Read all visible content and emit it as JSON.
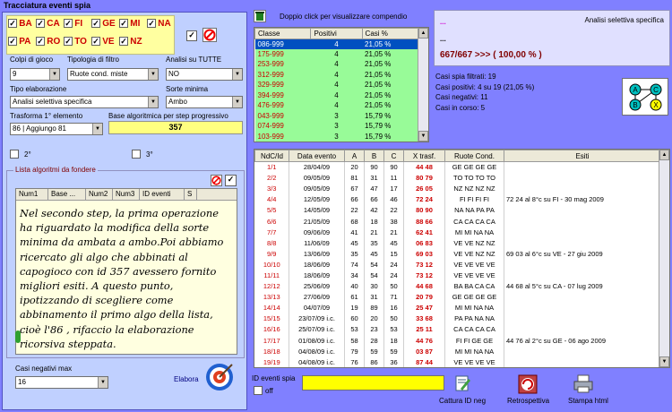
{
  "window": {
    "title": "Tracciatura eventi spia"
  },
  "wheels": [
    {
      "code": "BA",
      "checked": true
    },
    {
      "code": "CA",
      "checked": true
    },
    {
      "code": "FI",
      "checked": true
    },
    {
      "code": "GE",
      "checked": true
    },
    {
      "code": "MI",
      "checked": true
    },
    {
      "code": "NA",
      "checked": true
    },
    {
      "code": "PA",
      "checked": true
    },
    {
      "code": "RO",
      "checked": true
    },
    {
      "code": "TO",
      "checked": true
    },
    {
      "code": "VE",
      "checked": true
    },
    {
      "code": "NZ",
      "checked": true
    }
  ],
  "fields": {
    "colpi_label": "Colpi di gioco",
    "colpi_value": "9",
    "tipologia_label": "Tipologia di filtro",
    "tipologia_value": "Ruote cond. miste",
    "analisi_label": "Analisi su TUTTE",
    "analisi_value": "NO",
    "tipo_label": "Tipo elaborazione",
    "tipo_value": "Analisi selettiva specifica",
    "sorte_label": "Sorte minima",
    "sorte_value": "Ambo",
    "trasforma_label": "Trasforma 1° elemento",
    "trasforma_value": "86 | Aggiungo 81",
    "base_label": "Base algoritmica per step progressivo",
    "base_value": "357",
    "second_label": "2°",
    "third_label": "3°"
  },
  "fuse_list": {
    "title": "Lista algoritmi da fondere",
    "columns": [
      "Num1",
      "Base ...",
      "Num2",
      "Num3",
      "ID eventi",
      "S"
    ],
    "note": "Nel secondo step, la prima operazione ha riguardato la modifica della sorte minima da ambata a ambo.Poi abbiamo ricercato gli algo che abbinati al capogioco con id 357 avessero fornito migliori esiti. A questo punto, ipotizzando di scegliere come abbinamento il primo algo della lista, cioè l'86 , rifaccio la elaborazione ricorsiva steppata."
  },
  "casi_negativi": {
    "label": "Casi negativi max",
    "value": "16"
  },
  "elabora_label": "Elabora",
  "top_hint": "Doppio click per visualizzare compendio",
  "class_table": {
    "columns": [
      "Classe",
      "Positivi",
      "Casi %"
    ],
    "rows": [
      [
        "086-999",
        "4",
        "21,05 %"
      ],
      [
        "175-999",
        "4",
        "21,05 %"
      ],
      [
        "253-999",
        "4",
        "21,05 %"
      ],
      [
        "312-999",
        "4",
        "21,05 %"
      ],
      [
        "329-999",
        "4",
        "21,05 %"
      ],
      [
        "394-999",
        "4",
        "21,05 %"
      ],
      [
        "476-999",
        "4",
        "21,05 %"
      ],
      [
        "043-999",
        "3",
        "15,79 %"
      ],
      [
        "074-999",
        "3",
        "15,79 %"
      ],
      [
        "103-999",
        "3",
        "15,79 %"
      ]
    ]
  },
  "summary": {
    "mode": "Analisi selettiva specifica",
    "dots1": "...",
    "dots2": "...",
    "ratio": "667/667 >>> ( 100,00 % )",
    "stats": [
      "Casi spia filtrati: 19",
      "Casi positivi: 4 su 19 (21,05 %)",
      "Casi negativi: 11",
      "Casi in corso: 5"
    ]
  },
  "diagram": {
    "nodes": [
      "A",
      "C",
      "B",
      "X"
    ]
  },
  "events": {
    "columns": [
      "NdC/Id",
      "Data evento",
      "A",
      "B",
      "C",
      "X trasf.",
      "Ruote Cond.",
      "Esiti"
    ],
    "rows": [
      {
        "id": "1/1",
        "date": "28/04/09",
        "a": "20",
        "b": "90",
        "c": "90",
        "x": "44 48",
        "ruote": "GE GE GE GE",
        "esiti": ""
      },
      {
        "id": "2/2",
        "date": "09/05/09",
        "a": "81",
        "b": "31",
        "c": "11",
        "x": "80 79",
        "ruote": "TO TO TO TO",
        "esiti": ""
      },
      {
        "id": "3/3",
        "date": "09/05/09",
        "a": "67",
        "b": "47",
        "c": "17",
        "x": "26 05",
        "ruote": "NZ NZ NZ NZ",
        "esiti": ""
      },
      {
        "id": "4/4",
        "date": "12/05/09",
        "a": "66",
        "b": "66",
        "c": "46",
        "x": "72 24",
        "ruote": "FI FI FI FI",
        "esiti": "72 24 al 8°c su FI - 30 mag 2009"
      },
      {
        "id": "5/5",
        "date": "14/05/09",
        "a": "22",
        "b": "42",
        "c": "22",
        "x": "80 90",
        "ruote": "NA NA PA PA",
        "esiti": ""
      },
      {
        "id": "6/6",
        "date": "21/05/09",
        "a": "68",
        "b": "18",
        "c": "38",
        "x": "88 66",
        "ruote": "CA CA CA CA",
        "esiti": ""
      },
      {
        "id": "7/7",
        "date": "09/06/09",
        "a": "41",
        "b": "21",
        "c": "21",
        "x": "62 41",
        "ruote": "MI MI NA NA",
        "esiti": ""
      },
      {
        "id": "8/8",
        "date": "11/06/09",
        "a": "45",
        "b": "35",
        "c": "45",
        "x": "06 83",
        "ruote": "VE VE NZ NZ",
        "esiti": ""
      },
      {
        "id": "9/9",
        "date": "13/06/09",
        "a": "35",
        "b": "45",
        "c": "15",
        "x": "69 03",
        "ruote": "VE VE NZ NZ",
        "esiti": "69 03 al 6°c su VE - 27 giu 2009"
      },
      {
        "id": "10/10",
        "date": "18/06/09",
        "a": "74",
        "b": "54",
        "c": "24",
        "x": "73 12",
        "ruote": "VE VE VE VE",
        "esiti": ""
      },
      {
        "id": "11/11",
        "date": "18/06/09",
        "a": "34",
        "b": "54",
        "c": "24",
        "x": "73 12",
        "ruote": "VE VE VE VE",
        "esiti": ""
      },
      {
        "id": "12/12",
        "date": "25/06/09",
        "a": "40",
        "b": "30",
        "c": "50",
        "x": "44 68",
        "ruote": "BA BA CA CA",
        "esiti": "44 68 al 5°c su CA - 07 lug 2009"
      },
      {
        "id": "13/13",
        "date": "27/06/09",
        "a": "61",
        "b": "31",
        "c": "71",
        "x": "20 79",
        "ruote": "GE GE GE GE",
        "esiti": ""
      },
      {
        "id": "14/14",
        "date": "04/07/09",
        "a": "19",
        "b": "89",
        "c": "16",
        "x": "25 47",
        "ruote": "MI MI NA NA",
        "esiti": ""
      },
      {
        "id": "15/15",
        "date": "23/07/09 i.c.",
        "a": "60",
        "b": "20",
        "c": "50",
        "x": "33 68",
        "ruote": "PA PA NA NA",
        "esiti": ""
      },
      {
        "id": "16/16",
        "date": "25/07/09 i.c.",
        "a": "53",
        "b": "23",
        "c": "53",
        "x": "25 11",
        "ruote": "CA CA CA CA",
        "esiti": ""
      },
      {
        "id": "17/17",
        "date": "01/08/09 i.c.",
        "a": "58",
        "b": "28",
        "c": "18",
        "x": "44 76",
        "ruote": "FI FI GE GE",
        "esiti": "44 76 al 2°c su GE - 06 ago 2009"
      },
      {
        "id": "18/18",
        "date": "04/08/09 i.c.",
        "a": "79",
        "b": "59",
        "c": "59",
        "x": "03 87",
        "ruote": "MI MI NA NA",
        "esiti": ""
      },
      {
        "id": "19/19",
        "date": "04/08/09 i.c.",
        "a": "76",
        "b": "86",
        "c": "36",
        "x": "87 44",
        "ruote": "VE VE VE VE",
        "esiti": ""
      }
    ]
  },
  "bottom": {
    "id_label": "ID eventi spia",
    "off_label": "off",
    "id_value": "",
    "cattura_label": "Cattura ID neg",
    "retro_label": "Retrospettiva",
    "stampa_label": "Stampa html"
  },
  "colors": {
    "bg": "#8080ff",
    "panel": "#c0d0ff",
    "green": "#98fb98",
    "yellow": "#ffff00",
    "red": "#cc0000"
  }
}
